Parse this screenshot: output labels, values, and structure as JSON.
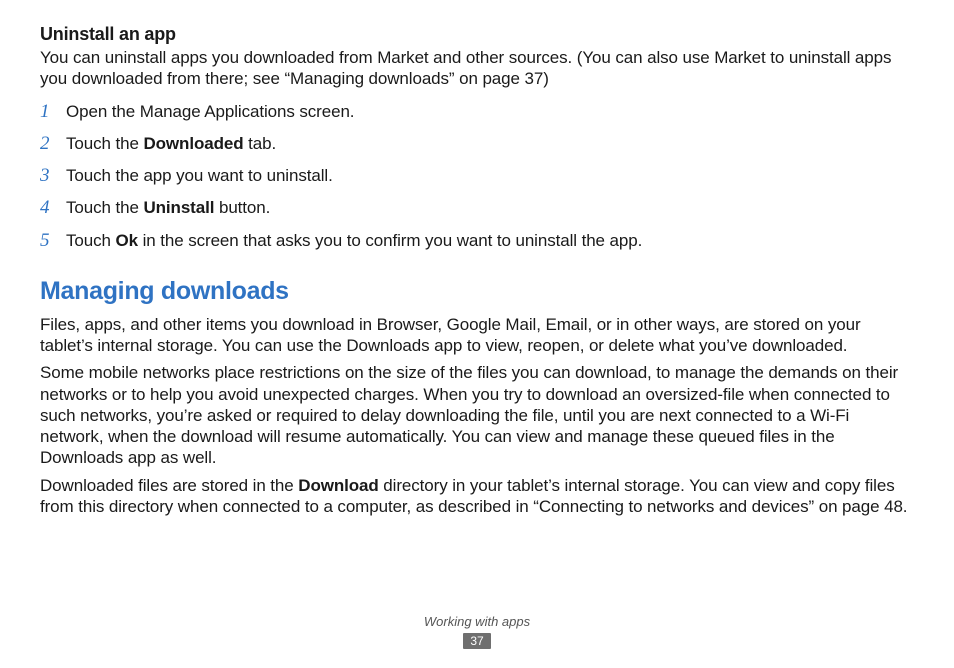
{
  "section1": {
    "title": "Uninstall an app",
    "intro": "You can uninstall apps you downloaded from Market and other sources. (You can also use Market to uninstall apps you downloaded from there; see “Managing downloads” on page 37)",
    "steps": [
      {
        "num": "1",
        "before": "Open the Manage Applications screen.",
        "bold": "",
        "after": ""
      },
      {
        "num": "2",
        "before": "Touch the ",
        "bold": "Downloaded",
        "after": " tab."
      },
      {
        "num": "3",
        "before": "Touch the app you want to uninstall.",
        "bold": "",
        "after": ""
      },
      {
        "num": "4",
        "before": "Touch the ",
        "bold": "Uninstall",
        "after": " button."
      },
      {
        "num": "5",
        "before": "Touch ",
        "bold": "Ok",
        "after": " in the screen that asks you to confirm you want to uninstall the app."
      }
    ]
  },
  "section2": {
    "title": "Managing downloads",
    "p1": "Files, apps, and other items you download in Browser, Google Mail, Email, or in other ways, are stored on your tablet’s internal storage. You can use the Downloads app to view, reopen, or delete what you’ve downloaded.",
    "p2": "Some mobile networks place restrictions on the size of the files you can download, to manage the demands on their networks or to help you avoid unexpected charges. When you try to download an oversized-file when connected to such networks, you’re asked or required to delay downloading the file, until you are next connected to a Wi-Fi network, when the download will resume automatically. You can view and manage these queued files in the Downloads app as well.",
    "p3_before": "Downloaded files are stored in the ",
    "p3_bold": "Download",
    "p3_after": " directory in your tablet’s internal storage. You can view and copy files from this directory when connected to a computer, as described in “Connecting to networks and devices” on page 48."
  },
  "footer": {
    "section": "Working with apps",
    "page": "37"
  }
}
